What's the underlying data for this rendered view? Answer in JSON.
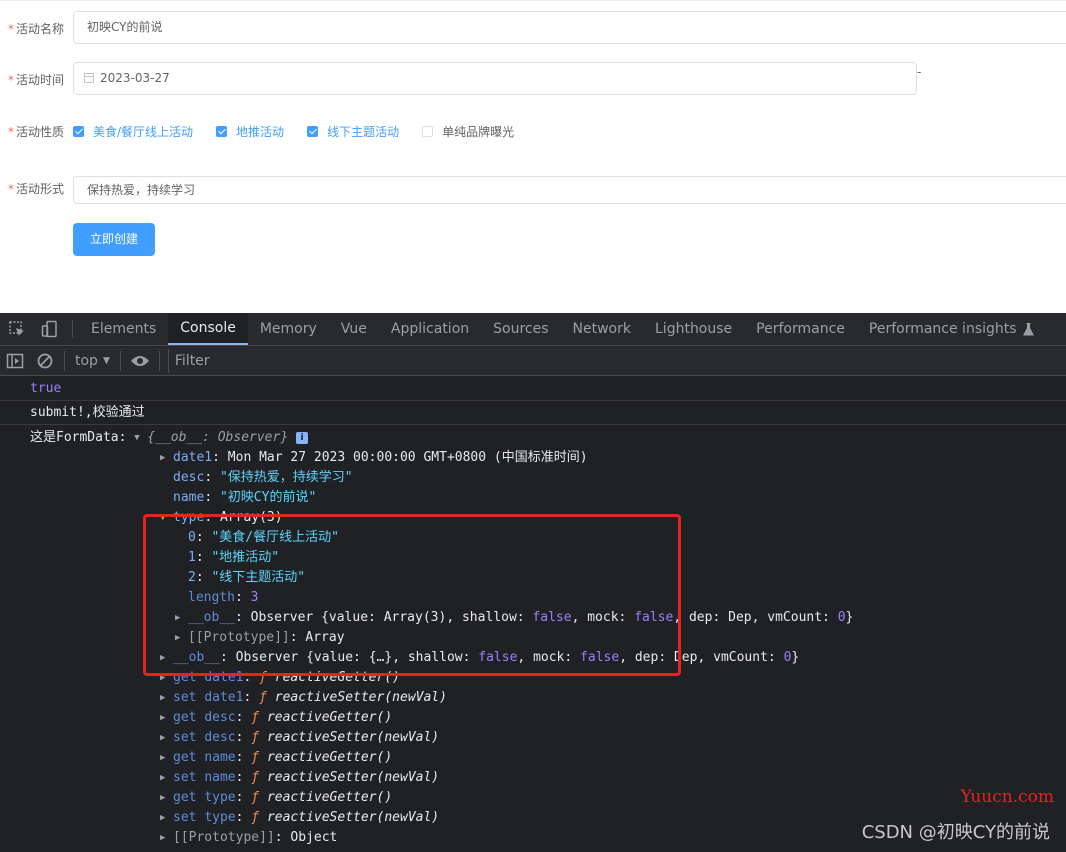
{
  "form": {
    "name": {
      "label": "活动名称",
      "value": "初映CY的前说"
    },
    "time": {
      "label": "活动时间",
      "value": "2023-03-27",
      "separator": "-"
    },
    "type": {
      "label": "活动性质",
      "options": [
        {
          "label": "美食/餐厅线上活动",
          "checked": true
        },
        {
          "label": "地推活动",
          "checked": true
        },
        {
          "label": "线下主题活动",
          "checked": true
        },
        {
          "label": "单纯品牌曝光",
          "checked": false
        }
      ]
    },
    "desc": {
      "label": "活动形式",
      "value": "保持热爱，持续学习"
    },
    "required_mark": "*",
    "submit_label": "立即创建"
  },
  "devtools": {
    "tabs": [
      "Elements",
      "Console",
      "Memory",
      "Vue",
      "Application",
      "Sources",
      "Network",
      "Lighthouse",
      "Performance",
      "Performance insights"
    ],
    "active_tab": "Console",
    "context": "top",
    "filter_placeholder": "Filter"
  },
  "console": {
    "msg_true": "true",
    "msg_submit": "submit!,校验通过",
    "formdata_prefix": "这是FormData: ",
    "formdata_summary": "{__ob__: Observer}",
    "info_badge": "i",
    "date1_key": "date1",
    "date1_val": "Mon Mar 27 2023 00:00:00 GMT+0800 (中国标准时间)",
    "desc_key": "desc",
    "desc_val": "\"保持热爱，持续学习\"",
    "name_key": "name",
    "name_val": "\"初映CY的前说\"",
    "type_key": "type",
    "type_val": "Array(3)",
    "items": [
      {
        "idx": "0",
        "val": "\"美食/餐厅线上活动\""
      },
      {
        "idx": "1",
        "val": "\"地推活动\""
      },
      {
        "idx": "2",
        "val": "\"线下主题活动\""
      }
    ],
    "length_key": "length",
    "length_val": "3",
    "arr_ob_line": {
      "key": "__ob__",
      "type": "Observer",
      "value_key": "value",
      "value": "Array(3)",
      "shallow": "false",
      "mock": "false",
      "dep": "Dep",
      "vmCount": "0"
    },
    "arr_proto_key": "[[Prototype]]",
    "arr_proto_val": "Array",
    "obj_ob_line": {
      "key": "__ob__",
      "type": "Observer",
      "value_key": "value",
      "value": "{…}",
      "shallow": "false",
      "mock": "false",
      "dep": "Dep",
      "vmCount": "0"
    },
    "accessors": [
      {
        "kind": "get",
        "prop": "date1",
        "fn": "reactiveGetter()"
      },
      {
        "kind": "set",
        "prop": "date1",
        "fn": "reactiveSetter(newVal)"
      },
      {
        "kind": "get",
        "prop": "desc",
        "fn": "reactiveGetter()"
      },
      {
        "kind": "set",
        "prop": "desc",
        "fn": "reactiveSetter(newVal)"
      },
      {
        "kind": "get",
        "prop": "name",
        "fn": "reactiveGetter()"
      },
      {
        "kind": "set",
        "prop": "name",
        "fn": "reactiveSetter(newVal)"
      },
      {
        "kind": "get",
        "prop": "type",
        "fn": "reactiveGetter()"
      },
      {
        "kind": "set",
        "prop": "type",
        "fn": "reactiveSetter(newVal)"
      }
    ],
    "obj_proto_key": "[[Prototype]]",
    "obj_proto_val": "Object",
    "f_glyph": "ƒ"
  },
  "watermark": {
    "site": "Yuucn.com",
    "author": "CSDN @初映CY的前说"
  },
  "colors": {
    "accent": "#409eff",
    "highlight_box": "#e8231f",
    "devtools_bg": "#202124"
  }
}
